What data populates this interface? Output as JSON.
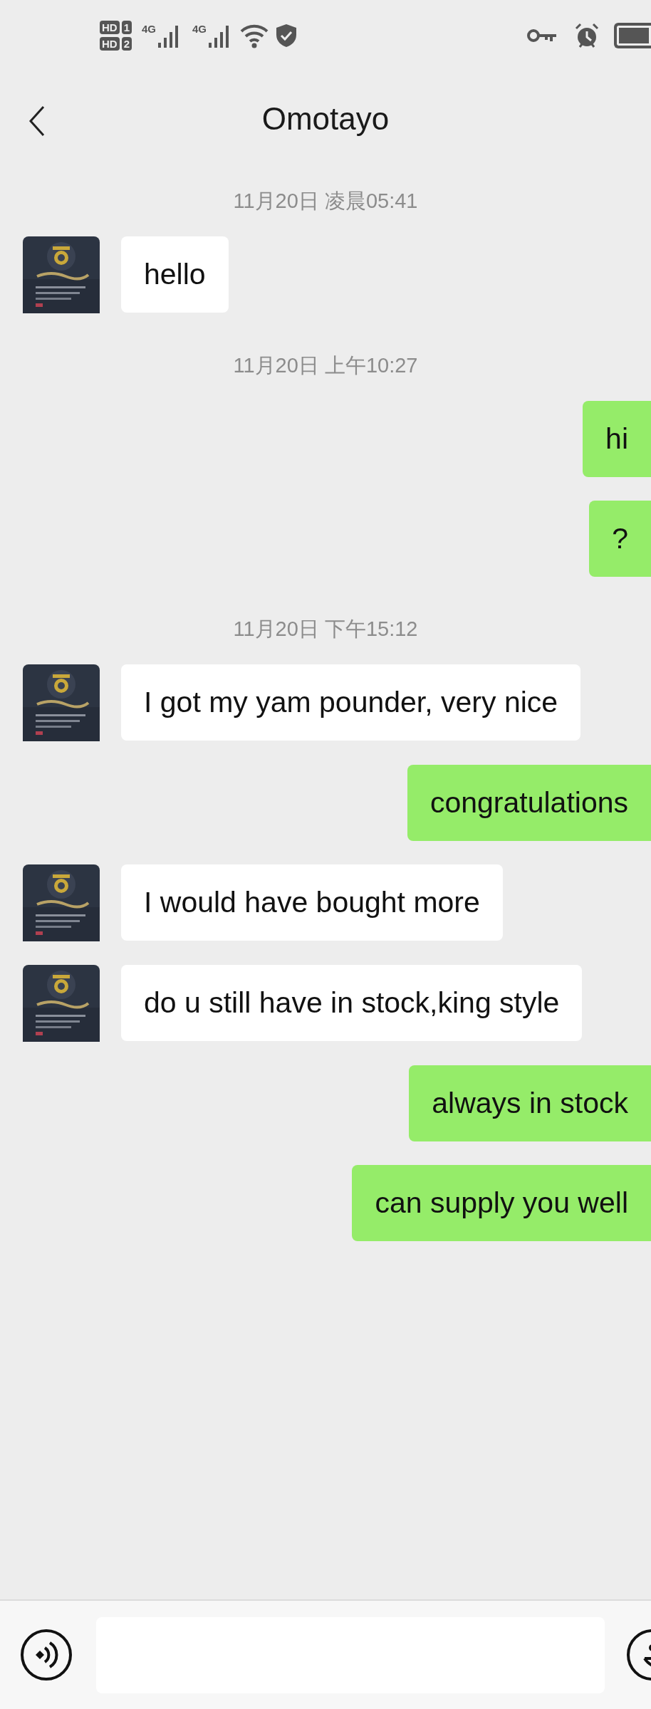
{
  "status_bar": {
    "sims": [
      {
        "badge": "HD",
        "slot": "1"
      },
      {
        "badge": "HD",
        "slot": "2"
      }
    ],
    "networks": [
      "4G",
      "4G"
    ]
  },
  "header": {
    "title": "Omotayo"
  },
  "messages": [
    {
      "kind": "time",
      "text": "11月20日 凌晨05:41"
    },
    {
      "kind": "received",
      "text": "hello"
    },
    {
      "kind": "time",
      "text": "11月20日 上午10:27"
    },
    {
      "kind": "sent",
      "text": "hi"
    },
    {
      "kind": "sent",
      "text": "?"
    },
    {
      "kind": "time",
      "text": "11月20日 下午15:12"
    },
    {
      "kind": "received",
      "text": "I got my yam pounder, very nice"
    },
    {
      "kind": "sent",
      "text": "congratulations"
    },
    {
      "kind": "received",
      "text": "I would have bought more"
    },
    {
      "kind": "received",
      "text": "do u still have in stock,king style"
    },
    {
      "kind": "sent",
      "text": "always in stock"
    },
    {
      "kind": "sent",
      "text": "can supply you well"
    }
  ]
}
